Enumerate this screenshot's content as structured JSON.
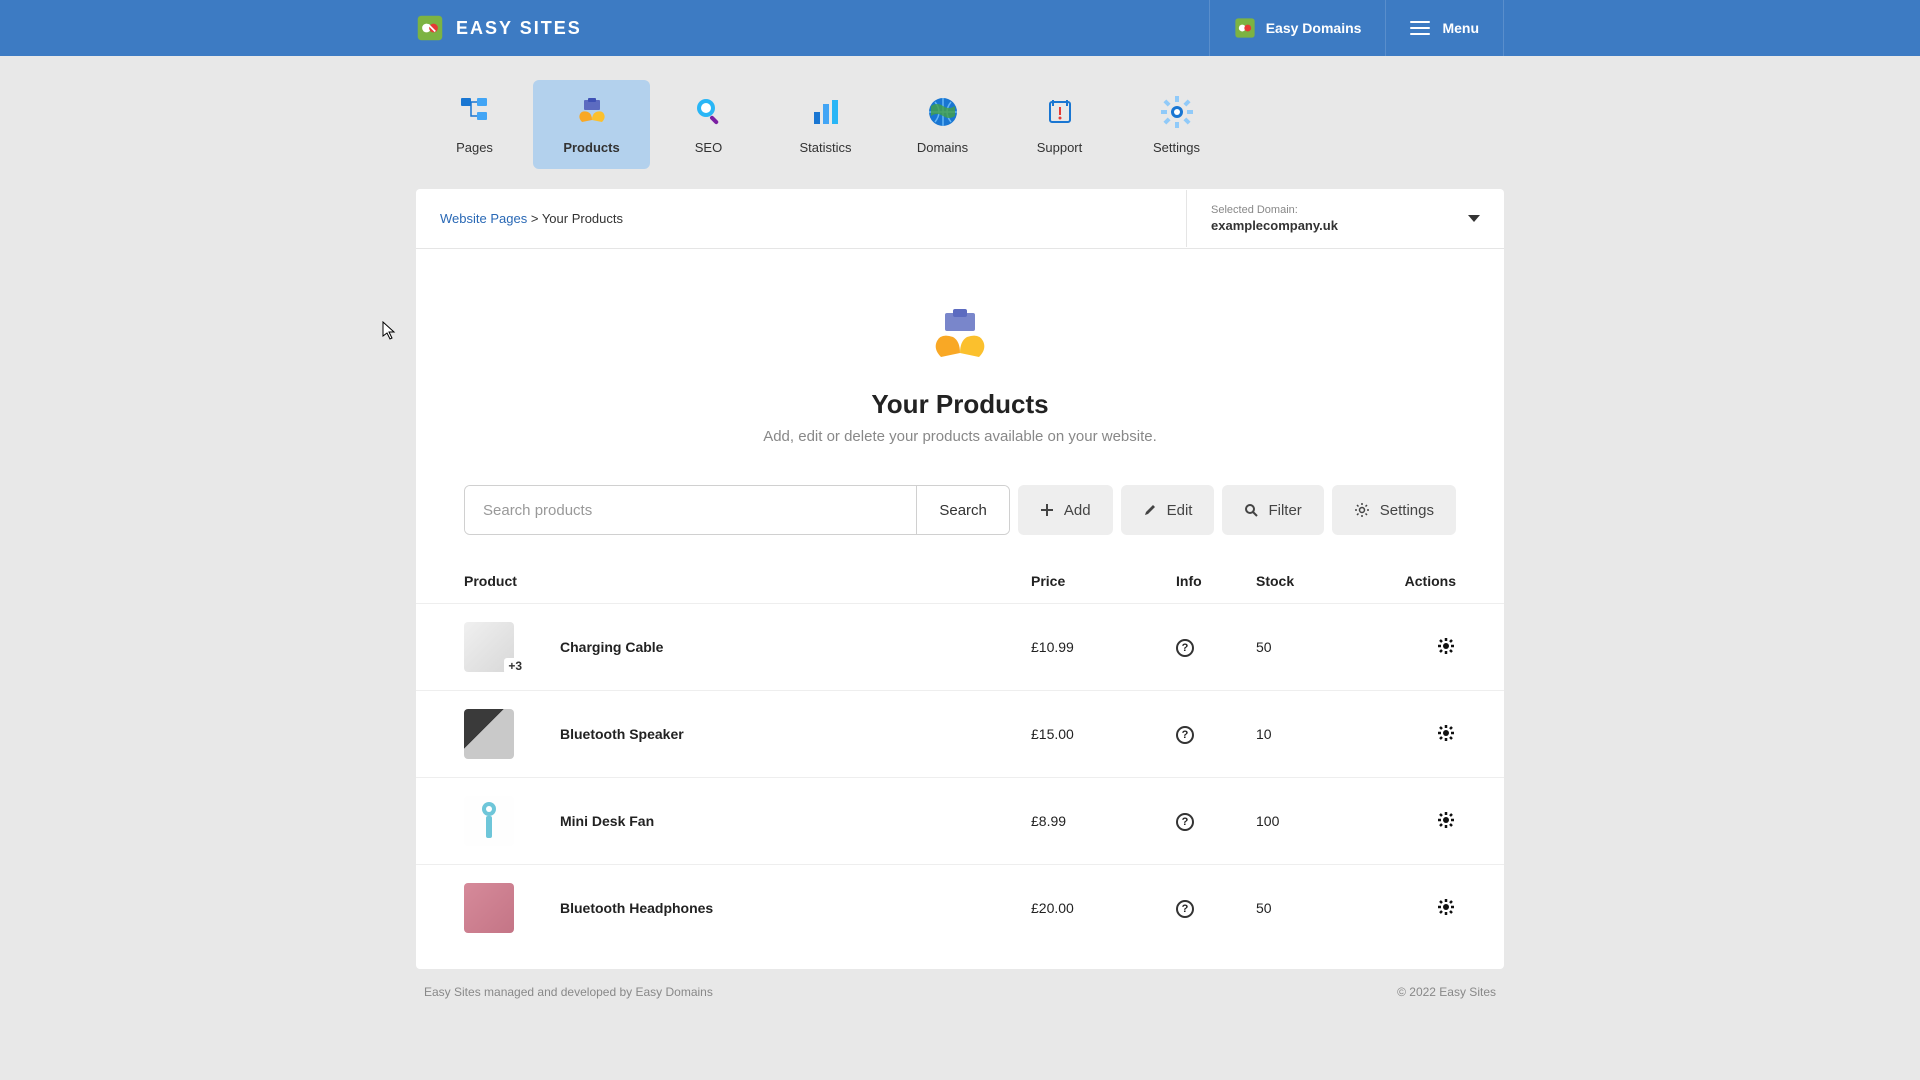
{
  "header": {
    "logo_text": "EASY SITES",
    "easy_domains": "Easy Domains",
    "menu": "Menu"
  },
  "nav": {
    "tabs": [
      {
        "label": "Pages"
      },
      {
        "label": "Products"
      },
      {
        "label": "SEO"
      },
      {
        "label": "Statistics"
      },
      {
        "label": "Domains"
      },
      {
        "label": "Support"
      },
      {
        "label": "Settings"
      }
    ]
  },
  "breadcrumb": {
    "root": "Website Pages",
    "sep": ">",
    "current": "Your Products"
  },
  "domain_selector": {
    "label": "Selected Domain:",
    "value": "examplecompany.uk"
  },
  "hero": {
    "title": "Your Products",
    "subtitle": "Add, edit or delete your products available on your website."
  },
  "toolbar": {
    "search_placeholder": "Search products",
    "search_btn": "Search",
    "add": "Add",
    "edit": "Edit",
    "filter": "Filter",
    "settings": "Settings"
  },
  "table": {
    "headers": {
      "product": "Product",
      "price": "Price",
      "info": "Info",
      "stock": "Stock",
      "actions": "Actions"
    },
    "rows": [
      {
        "name": "Charging Cable",
        "price": "£10.99",
        "stock": "50",
        "badge": "+3"
      },
      {
        "name": "Bluetooth Speaker",
        "price": "£15.00",
        "stock": "10",
        "badge": ""
      },
      {
        "name": "Mini Desk Fan",
        "price": "£8.99",
        "stock": "100",
        "badge": ""
      },
      {
        "name": "Bluetooth Headphones",
        "price": "£20.00",
        "stock": "50",
        "badge": ""
      }
    ]
  },
  "footer": {
    "left": "Easy Sites managed and developed by Easy Domains",
    "right": "© 2022 Easy Sites"
  },
  "info_glyph": "?"
}
